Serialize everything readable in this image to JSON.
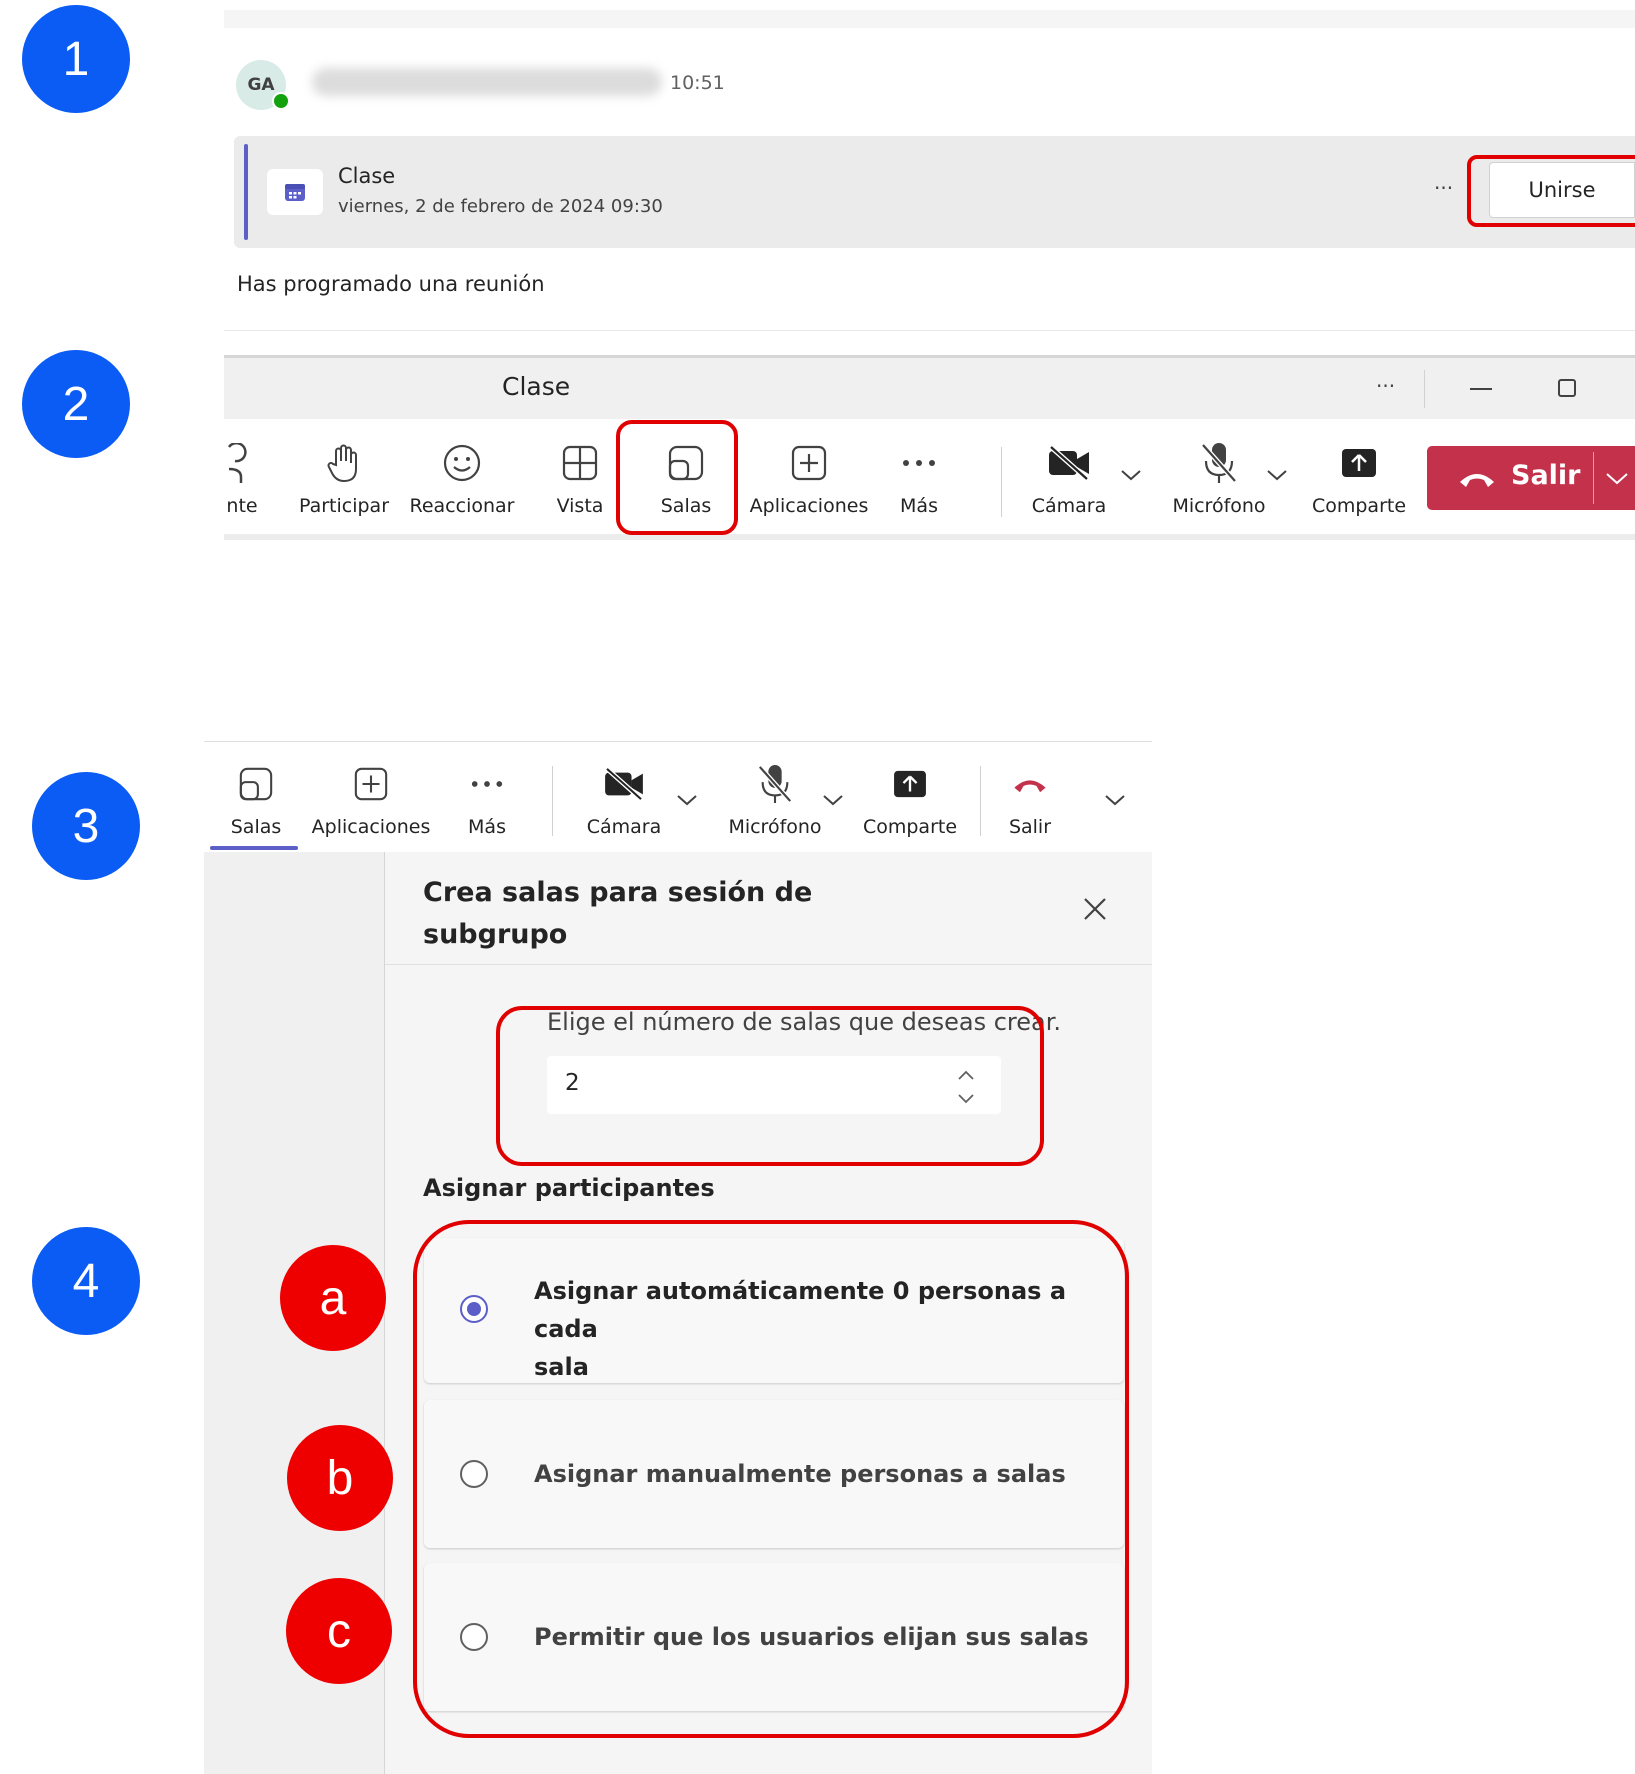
{
  "steps": [
    "1",
    "2",
    "3",
    "4"
  ],
  "substeps": [
    "a",
    "b",
    "c"
  ],
  "chat": {
    "avatar_initials": "GA",
    "time": "10:51",
    "meeting_title": "Clase",
    "meeting_date": "viernes, 2 de febrero de 2024 09:30",
    "more": "···",
    "join_label": "Unirse",
    "footer": "Has programado una reunión"
  },
  "meeting_window": {
    "title": "Clase",
    "more": "···",
    "toolbar": [
      {
        "label": "nte",
        "icon": "person-icon"
      },
      {
        "label": "Participar",
        "icon": "raise-hand-icon"
      },
      {
        "label": "Reaccionar",
        "icon": "smiley-icon"
      },
      {
        "label": "Vista",
        "icon": "grid-icon"
      },
      {
        "label": "Salas",
        "icon": "breakout-rooms-icon"
      },
      {
        "label": "Aplicaciones",
        "icon": "add-app-icon"
      },
      {
        "label": "Más",
        "icon": "more-icon"
      },
      {
        "label": "Cámara",
        "icon": "camera-off-icon"
      },
      {
        "label": "Micrófono",
        "icon": "mic-off-icon"
      },
      {
        "label": "Comparte",
        "icon": "share-icon"
      }
    ],
    "leave_label": "Salir"
  },
  "panel": {
    "toolbar": [
      {
        "label": "Salas",
        "icon": "breakout-rooms-icon"
      },
      {
        "label": "Aplicaciones",
        "icon": "add-app-icon"
      },
      {
        "label": "Más",
        "icon": "more-icon"
      },
      {
        "label": "Cámara",
        "icon": "camera-off-icon"
      },
      {
        "label": "Micrófono",
        "icon": "mic-off-icon"
      },
      {
        "label": "Comparte",
        "icon": "share-icon"
      },
      {
        "label": "Salir",
        "icon": "hang-up-icon"
      }
    ],
    "title_line1": "Crea salas para sesión de",
    "title_line2": "subgrupo",
    "rooms_label": "Elige el número de salas que deseas crear.",
    "rooms_value": "2",
    "assign_heading": "Asignar participantes",
    "options": [
      {
        "line1": "Asignar automáticamente 0 personas a cada",
        "line2": "sala",
        "selected": true
      },
      {
        "line1": "Asignar manualmente personas a salas",
        "line2": "",
        "selected": false
      },
      {
        "line1": "Permitir que los usuarios elijan sus salas",
        "line2": "",
        "selected": false
      }
    ]
  },
  "colors": {
    "step_blue": "#0a5cf5",
    "annotation_red": "#e00000",
    "teams_purple": "#5b5fc7",
    "leave_red": "#c4314b"
  }
}
